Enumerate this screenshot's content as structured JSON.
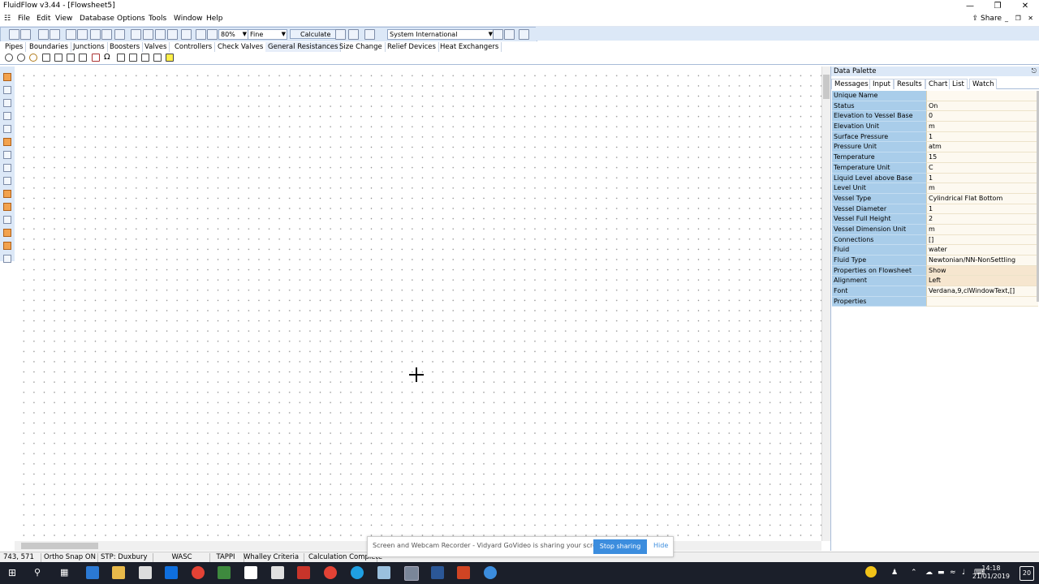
{
  "window": {
    "title": "FluidFlow v3.44 - [Flowsheet5]"
  },
  "menu": [
    "File",
    "Edit",
    "View",
    "Database",
    "Options",
    "Tools",
    "Window",
    "Help"
  ],
  "share_label": "Share",
  "toolbar": {
    "zoom": "80%",
    "grid_mode": "Fine",
    "calculate_label": "Calculate",
    "unit_system": "System International"
  },
  "component_tabs": [
    "Pipes",
    "Boundaries",
    "Junctions",
    "Boosters",
    "Valves",
    "Controllers",
    "Check Valves",
    "General Resistances",
    "Size Change",
    "Relief Devices",
    "Heat Exchangers"
  ],
  "data_palette": {
    "title": "Data Palette",
    "tabs": [
      "Messages",
      "Input",
      "Results",
      "Chart",
      "List",
      "Watch"
    ],
    "rows": [
      {
        "key": "Unique Name",
        "value": ""
      },
      {
        "key": "Status",
        "value": "On"
      },
      {
        "key": "Elevation to Vessel Base",
        "value": "0"
      },
      {
        "key": "Elevation Unit",
        "value": "m"
      },
      {
        "key": "Surface Pressure",
        "value": "1"
      },
      {
        "key": "Pressure Unit",
        "value": "atm"
      },
      {
        "key": "Temperature",
        "value": "15"
      },
      {
        "key": "Temperature Unit",
        "value": "C"
      },
      {
        "key": "Liquid Level above Base",
        "value": "1"
      },
      {
        "key": "Level Unit",
        "value": "m"
      },
      {
        "key": "Vessel Type",
        "value": "Cylindrical Flat Bottom"
      },
      {
        "key": "Vessel Diameter",
        "value": "1"
      },
      {
        "key": "Vessel Full Height",
        "value": "2"
      },
      {
        "key": "Vessel Dimension Unit",
        "value": "m"
      },
      {
        "key": "Connections",
        "value": "[]"
      },
      {
        "key": "Fluid",
        "value": "water"
      },
      {
        "key": "Fluid Type",
        "value": "Newtonian/NN-NonSettling"
      },
      {
        "key": "Properties on Flowsheet",
        "value": "Show"
      },
      {
        "key": "Alignment",
        "value": "Left"
      },
      {
        "key": "Font",
        "value": "Verdana,9,clWindowText,[]"
      },
      {
        "key": "Properties",
        "value": ""
      }
    ]
  },
  "statusbar": [
    "743, 571",
    "Ortho Snap ON",
    "STP: Duxbury",
    "WASC",
    "TAPPI",
    "Whalley Criteria",
    "Calculation Complete"
  ],
  "share_notice": {
    "message": "Screen and Webcam Recorder - Vidyard GoVideo is sharing your screen.",
    "stop_label": "Stop sharing",
    "hide_label": "Hide"
  },
  "clock": {
    "time": "14:18",
    "date": "21/01/2019"
  },
  "notifications_count": "20"
}
